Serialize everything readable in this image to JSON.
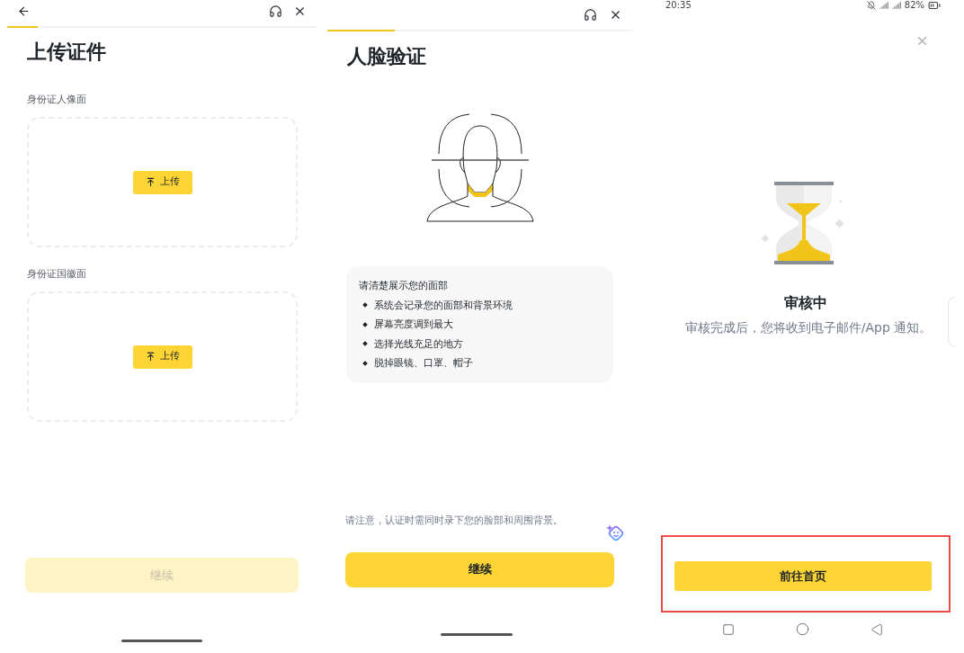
{
  "upload_screen": {
    "progress": {
      "level": 0.1
    },
    "title": "上传证件",
    "sections": [
      {
        "label": "身份证人像面",
        "button": "上传"
      },
      {
        "label": "身份证国徽面",
        "button": "上传"
      }
    ],
    "continue_button": {
      "label": "继续",
      "disabled": true
    }
  },
  "face_screen": {
    "progress": {
      "level": 0.22
    },
    "title": "人脸验证",
    "tips": {
      "heading": "请清楚展示您的面部",
      "items": [
        "系统会记录您的面部和背景环境",
        "屏幕亮度调到最大",
        "选择光线充足的地方",
        "脱掉眼镜、口罩、帽子"
      ]
    },
    "note": "请注意，认证时需同时录下您的脸部和周围背景。",
    "continue_button": {
      "label": "继续",
      "disabled": false
    }
  },
  "review_screen": {
    "status_bar": {
      "time": "20:35",
      "battery": "82%"
    },
    "title": "审核中",
    "message": "审核完成后，您将收到电子邮件/App 通知。",
    "home_button": {
      "label": "前往首页",
      "highlighted": true
    }
  }
}
